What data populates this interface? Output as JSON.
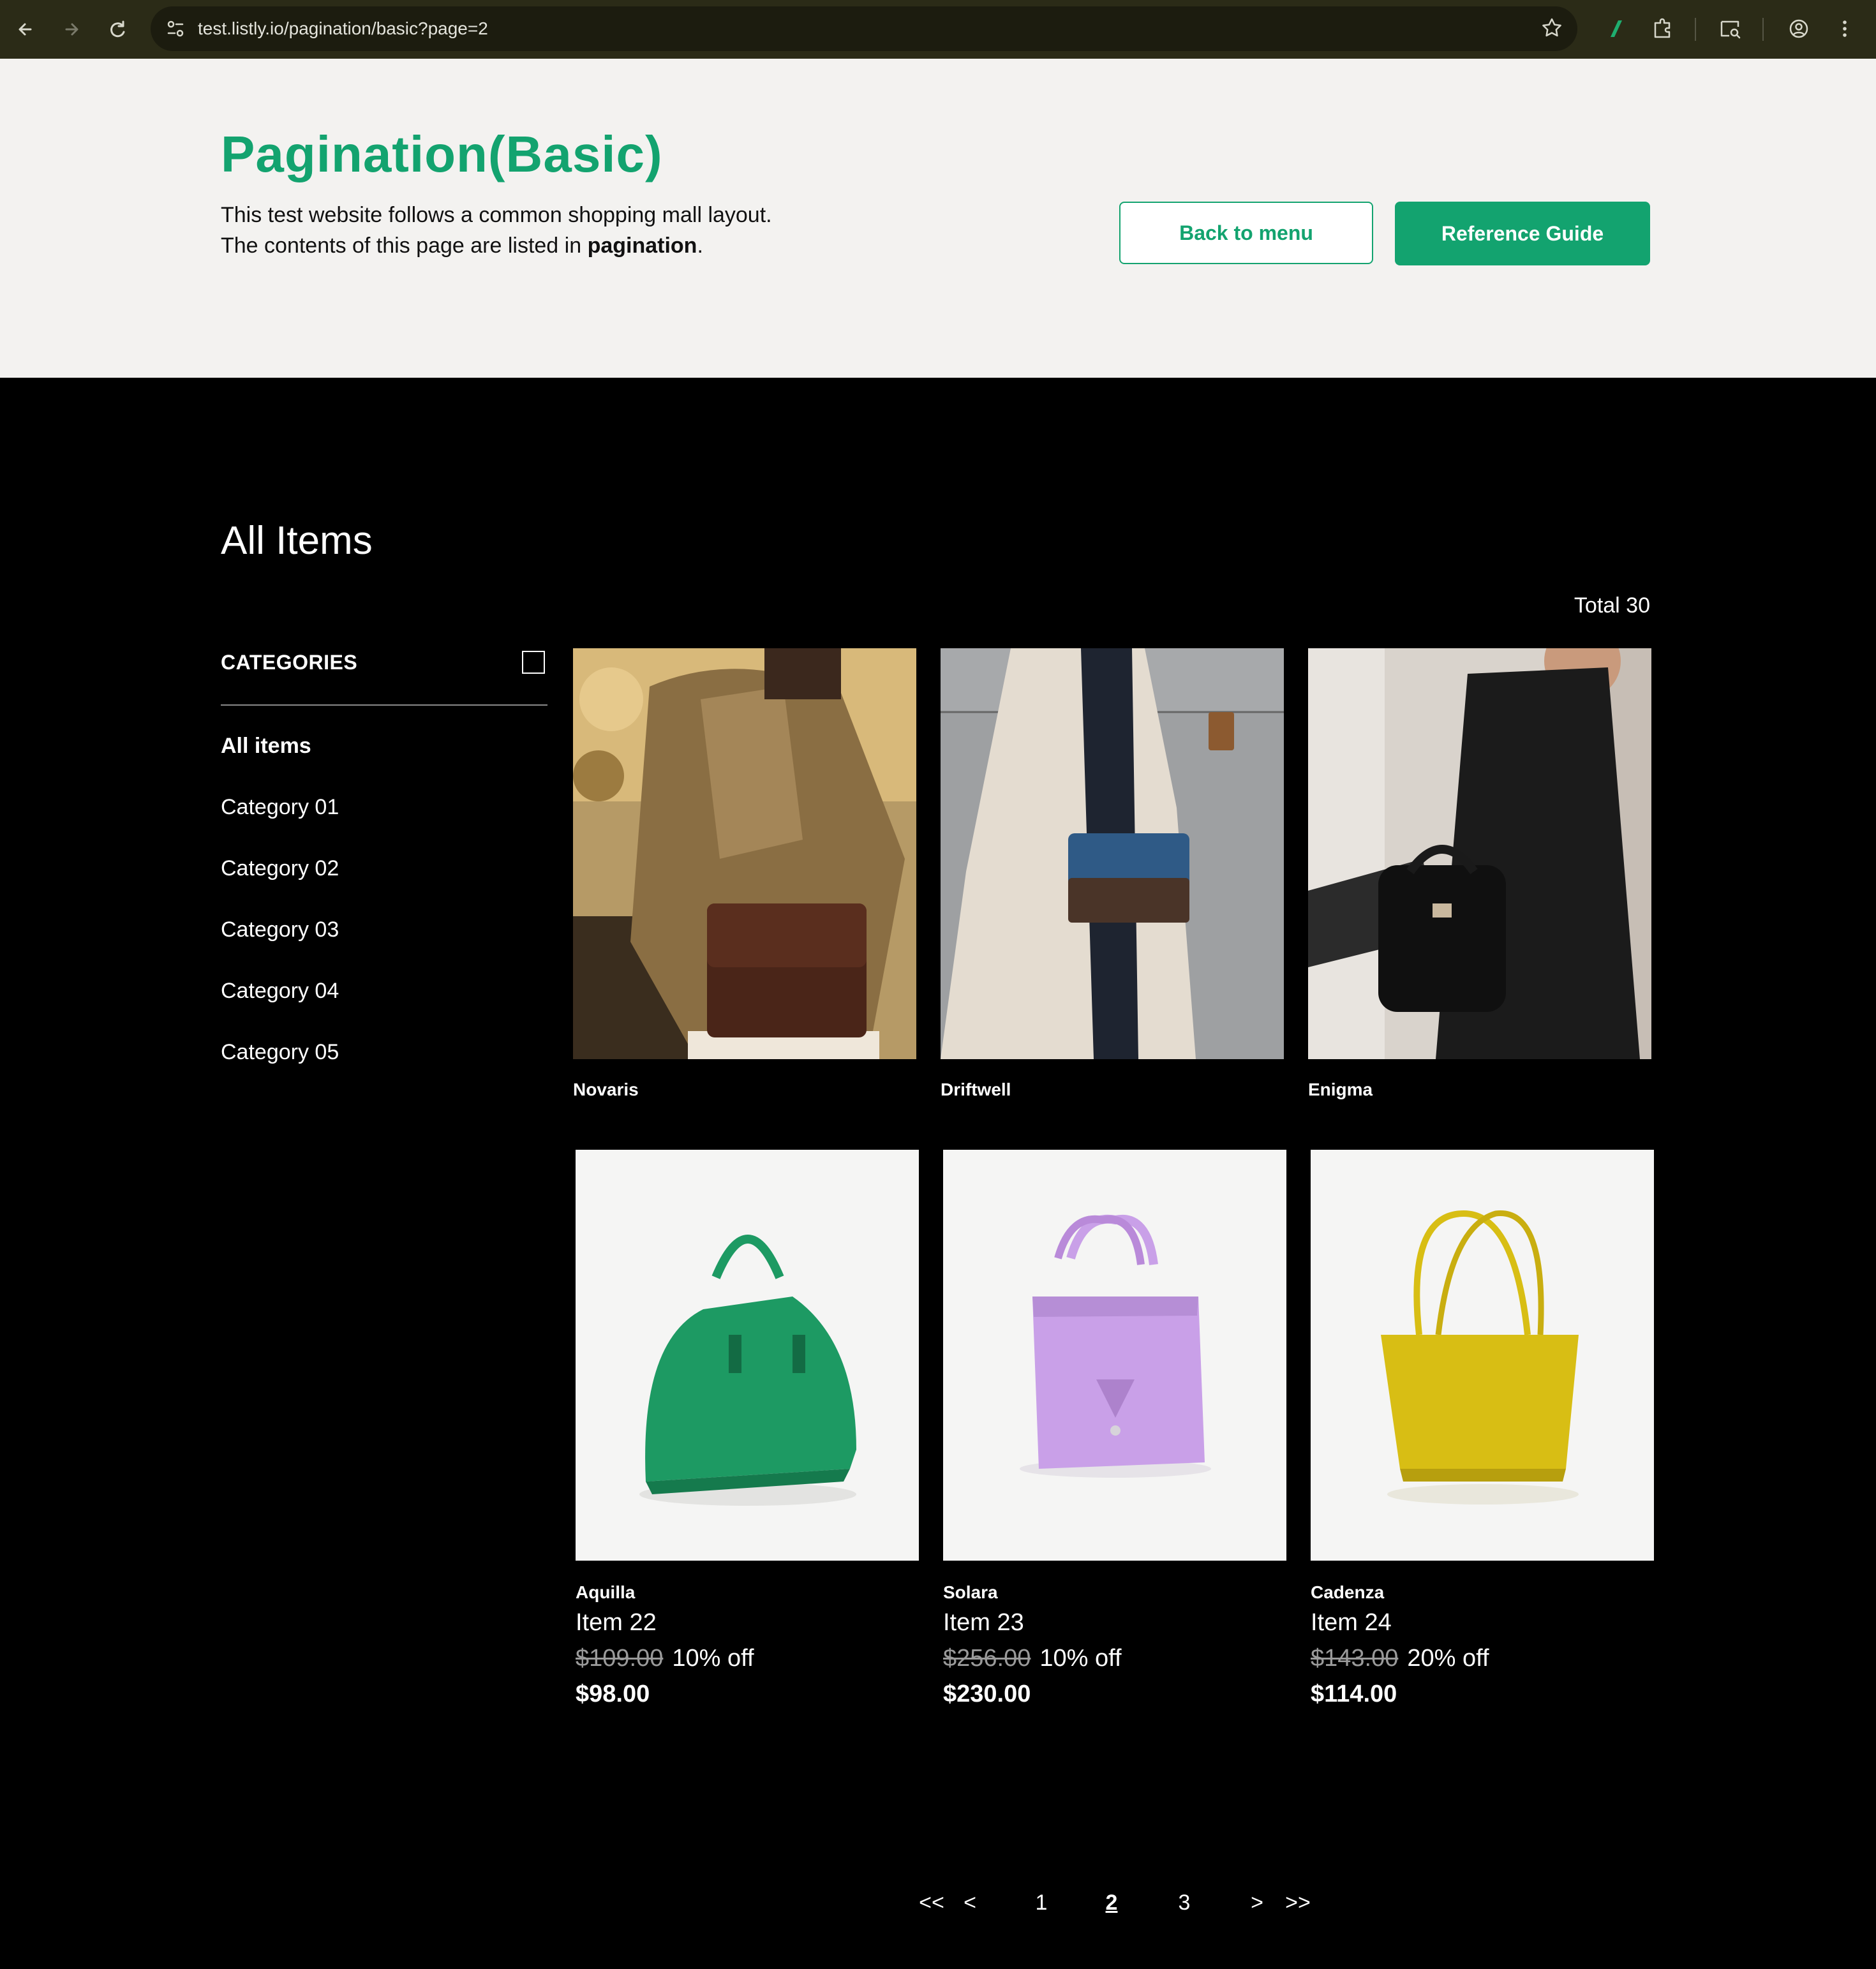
{
  "browser": {
    "url": "test.listly.io/pagination/basic?page=2"
  },
  "hero": {
    "title": "Pagination(Basic)",
    "desc_line1": "This test website follows a common shopping mall layout.",
    "desc_line2_prefix": "The contents of this page are listed in ",
    "desc_line2_bold": "pagination",
    "desc_line2_suffix": ".",
    "back_button": "Back to menu",
    "reference_button": "Reference Guide"
  },
  "content": {
    "title": "All Items",
    "total": "Total 30"
  },
  "categories": {
    "header": "CATEGORIES",
    "items": [
      "All items",
      "Category 01",
      "Category 02",
      "Category 03",
      "Category 04",
      "Category 05"
    ]
  },
  "products_top": [
    {
      "brand": "Novaris"
    },
    {
      "brand": "Driftwell"
    },
    {
      "brand": "Enigma"
    }
  ],
  "products_bottom": [
    {
      "brand": "Aquilla",
      "name": "Item 22",
      "original_price": "$109.00",
      "discount": "10% off",
      "price": "$98.00",
      "bag_color": "#1d9a63"
    },
    {
      "brand": "Solara",
      "name": "Item 23",
      "original_price": "$256.00",
      "discount": "10% off",
      "price": "$230.00",
      "bag_color": "#c9a0e8"
    },
    {
      "brand": "Cadenza",
      "name": "Item 24",
      "original_price": "$143.00",
      "discount": "20% off",
      "price": "$114.00",
      "bag_color": "#d8be14"
    }
  ],
  "pagination": {
    "first": "<<",
    "prev": "<",
    "pages": [
      "1",
      "2",
      "3"
    ],
    "current": "2",
    "next": ">",
    "last": ">>"
  }
}
